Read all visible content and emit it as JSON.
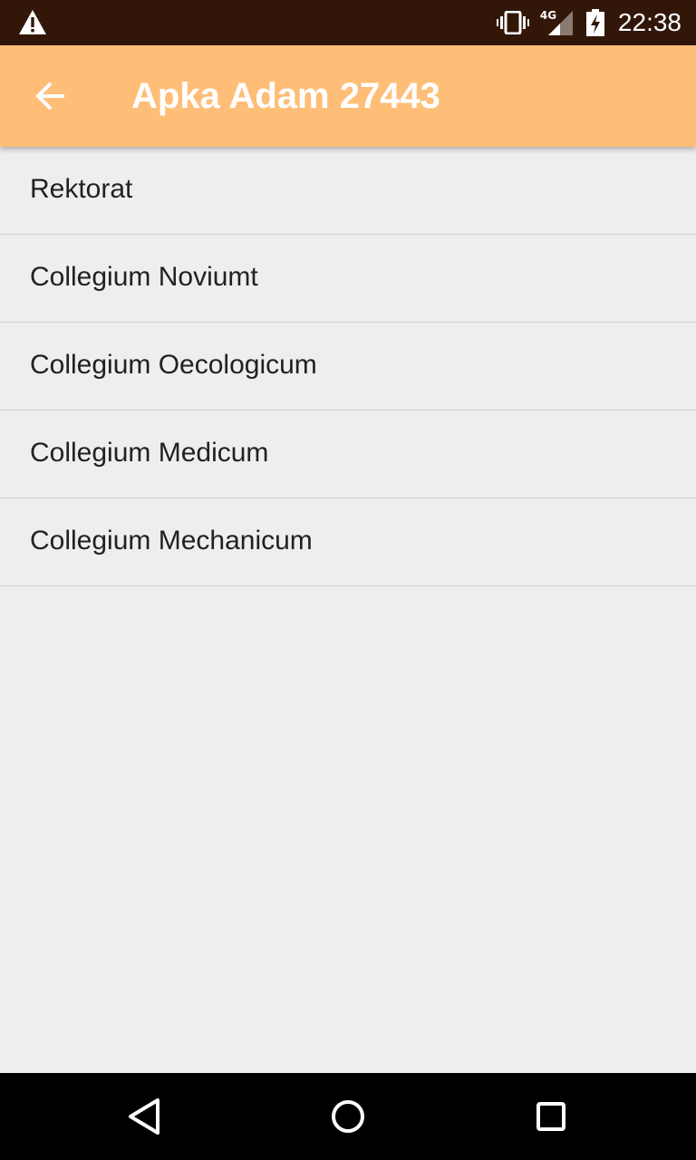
{
  "status_bar": {
    "warning_icon": "warning-icon",
    "vibrate_icon": "vibrate-icon",
    "network_type": "4G",
    "signal_icon": "signal-icon",
    "battery_icon": "battery-charging-icon",
    "time": "22:38"
  },
  "app_bar": {
    "back_icon": "arrow-back-icon",
    "title": "Apka Adam 27443",
    "color": "#ffbe78"
  },
  "list": {
    "items": [
      {
        "label": "Rektorat"
      },
      {
        "label": "Collegium Noviumt"
      },
      {
        "label": "Collegium Oecologicum"
      },
      {
        "label": "Collegium Medicum"
      },
      {
        "label": "Collegium Mechanicum"
      }
    ]
  },
  "nav_bar": {
    "back_icon": "nav-back-icon",
    "home_icon": "nav-home-icon",
    "recents_icon": "nav-recents-icon"
  }
}
